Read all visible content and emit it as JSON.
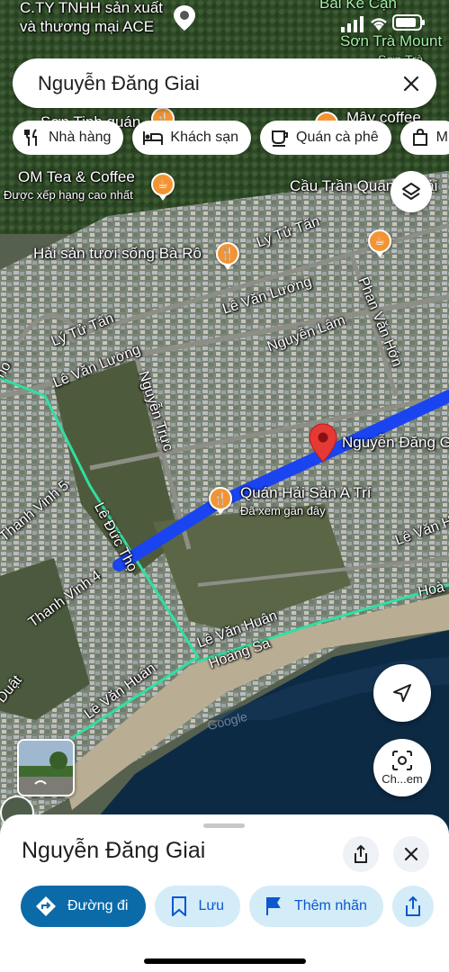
{
  "status_bar": {
    "carrier_overlay": "C.TY TNHH sản xuất",
    "carrier_overlay_2": "và thương mại ACE"
  },
  "search": {
    "query": "Nguyễn Đăng Giai"
  },
  "chips": [
    {
      "label": "Nhà hàng",
      "icon": "restaurant-icon"
    },
    {
      "label": "Khách sạn",
      "icon": "hotel-icon"
    },
    {
      "label": "Quán cà phê",
      "icon": "coffee-icon"
    },
    {
      "label": "M",
      "icon": "shopping-bag-icon"
    }
  ],
  "map": {
    "places": {
      "ba_ke_can": "Bãi Kẻ Cạn",
      "son_tra": "Sơn Trà Mount",
      "son_tra_2": "Sơn Trà",
      "son_tinh_quan": "Sơn Tinh quán",
      "may_coffee": "Mây coffee",
      "om_tea": "OM Tea & Coffee",
      "om_tea_sub": "Được xếp hạng cao nhất",
      "cau_tran_quang_khai": "Cầu Trần Quang Khải",
      "hai_san_ba_ro": "Hải sản tươi sống Bà Rô",
      "quan_hai_san": "Quán Hải Sản A Trí",
      "quan_hai_san_sub": "Đã xem gần đây",
      "pin_label": "Nguyễn Đăng G",
      "google": "Google"
    },
    "roads": {
      "ly_tu_tan_1": "Lý Tử Tấn",
      "ly_tu_tan_2": "Lý Tử Tấn",
      "le_van_luong_1": "Lê Văn Lương",
      "le_van_luong_2": "Lê Văn Lương",
      "nguyen_lam": "Nguyễn Lâm",
      "phan_van_hon": "Phan Văn Hớn",
      "nguyen_truc": "Nguyễn Trực",
      "le_duc_tho": "Lê Đức Thọ",
      "thanh_vinh_5": "Thanh Vinh 5",
      "thanh_vinh_4": "Thanh Vinh 4",
      "le_van_huan_1": "Lê Văn Huân",
      "le_van_huan_2": "Lê Văn Huân",
      "le_van_huan_3": "Lê Văn Hu",
      "hoang_sa_1": "Hoàng Sa",
      "hoang_sa_2": "Hoà",
      "duat": "Duật",
      "ho": "ho"
    }
  },
  "controls": {
    "layers": "layers-icon",
    "my_location": "navigation-arrow-icon",
    "lens_label": "Ch...em"
  },
  "sheet": {
    "title": "Nguyễn Đăng Giai",
    "actions": [
      {
        "label": "Đường đi",
        "icon": "directions-icon"
      },
      {
        "label": "Lưu",
        "icon": "bookmark-icon"
      },
      {
        "label": "Thêm nhãn",
        "icon": "flag-icon"
      }
    ]
  },
  "colors": {
    "route_blue": "#1a44f0",
    "route_green": "#2fe0a0",
    "pin_red": "#e53935",
    "poi_orange": "#f29434",
    "sea": "#0d2a45",
    "primary_button": "#0b6aa8"
  }
}
